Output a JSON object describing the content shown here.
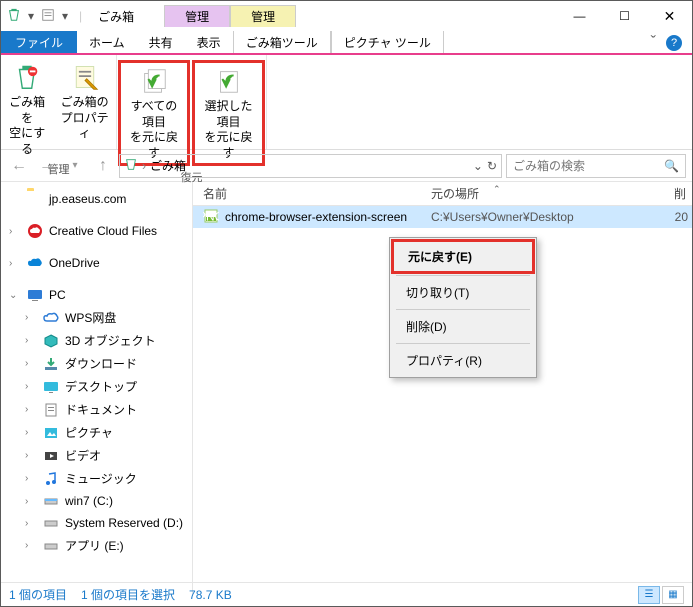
{
  "title": "ごみ箱",
  "toolTabs": {
    "purple": "管理",
    "yellow": "管理"
  },
  "window": {
    "min": "—",
    "max": "☐",
    "close": "✕"
  },
  "menu": {
    "file": "ファイル",
    "tabs": [
      "ホーム",
      "共有",
      "表示"
    ],
    "sub": [
      "ごみ箱ツール",
      "ピクチャ ツール"
    ],
    "chev": "ˇ"
  },
  "ribbon": {
    "manage": {
      "label": "管理",
      "empty": "ごみ箱を\n空にする",
      "props": "ごみ箱の\nプロパティ"
    },
    "restore": {
      "label": "復元",
      "all": "すべての項目\nを元に戻す",
      "sel": "選択した項目\nを元に戻す"
    }
  },
  "addr": {
    "location": "ごみ箱",
    "sep": "›"
  },
  "search": {
    "placeholder": "ごみ箱の検索"
  },
  "tree": {
    "easeus": "jp.easeus.com",
    "ccf": "Creative Cloud Files",
    "onedrive": "OneDrive",
    "pc": "PC",
    "wps": "WPS网盘",
    "obj3d": "3D オブジェクト",
    "dl": "ダウンロード",
    "desk": "デスクトップ",
    "docs": "ドキュメント",
    "pics": "ピクチャ",
    "vids": "ビデオ",
    "music": "ミュージック",
    "win7": "win7 (C:)",
    "sysr": "System Reserved (D:)",
    "apps": "アプリ (E:)"
  },
  "columns": {
    "name": "名前",
    "loc": "元の場所",
    "end": "削"
  },
  "rows": [
    {
      "name": "chrome-browser-extension-screen",
      "loc": "C:¥Users¥Owner¥Desktop",
      "end": "20"
    }
  ],
  "ctx": {
    "restore": "元に戻す(E)",
    "cut": "切り取り(T)",
    "del": "削除(D)",
    "props": "プロパティ(R)"
  },
  "status": {
    "count": "1 個の項目",
    "sel": "1 個の項目を選択",
    "size": "78.7 KB"
  }
}
